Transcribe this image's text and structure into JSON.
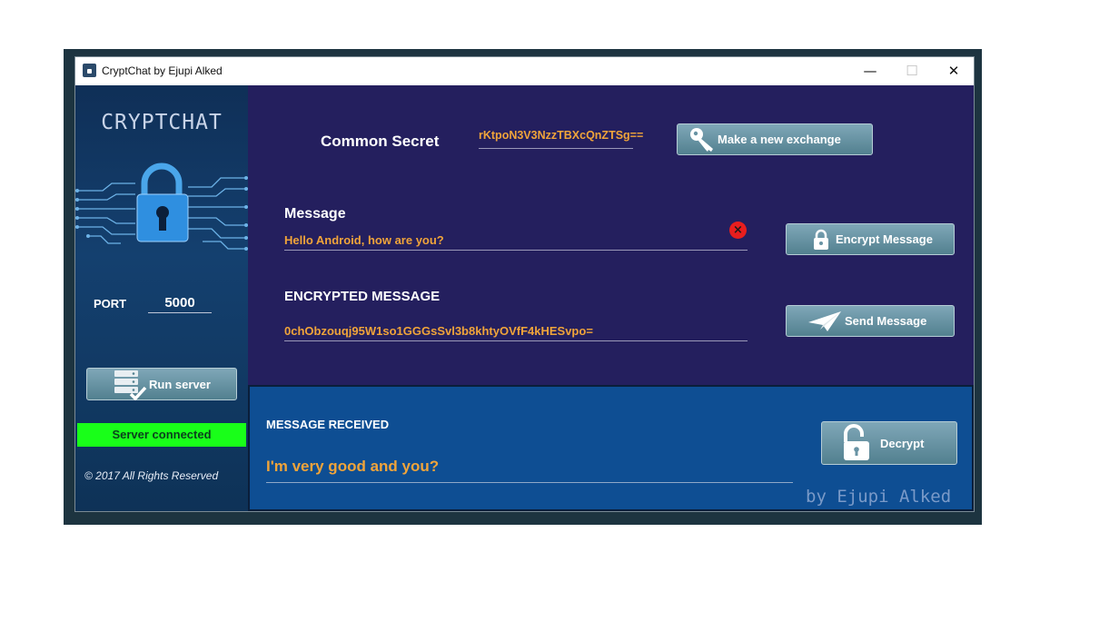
{
  "window": {
    "title": "CryptChat by Ejupi Alked",
    "controls": {
      "minimize": "—",
      "maximize": "☐",
      "close": "✕"
    }
  },
  "sidebar": {
    "logo_text": "CRYPTCHAT",
    "port_label": "PORT",
    "port_value": "5000",
    "run_server_label": "Run server",
    "status_text": "Server connected",
    "copyright": "© 2017 All Rights Reserved"
  },
  "main": {
    "common_secret_label": "Common Secret",
    "common_secret_value": "rKtpoN3V3NzzTBXcQnZTSg==",
    "exchange_button_label": "Make a new exchange",
    "message_label": "Message",
    "message_value": "Hello Android, how are you?",
    "encrypt_button_label": "Encrypt Message",
    "encrypted_label": "ENCRYPTED MESSAGE",
    "encrypted_value": "0chObzouqj95W1so1GGGsSvl3b8khtyOVfF4kHESvpo=",
    "send_button_label": "Send Message"
  },
  "received": {
    "label": "MESSAGE RECEIVED",
    "value": "I'm very good and you?",
    "decrypt_button_label": "Decrypt",
    "signature": "by Ejupi Alked"
  },
  "icons": {
    "app": "lock-icon",
    "exchange": "key-icon",
    "encrypt": "lock-icon",
    "send": "paper-plane-icon",
    "decrypt": "unlocked-lock-icon",
    "run_server": "server-check-icon",
    "clear": "clear-x-icon"
  },
  "colors": {
    "main_bg": "#241f5e",
    "received_bg": "#0e4e93",
    "sidebar_bg": "#14406f",
    "accent_text": "#f0a43a",
    "status_bg": "#19ff19",
    "button_bg": "#6893a4"
  }
}
